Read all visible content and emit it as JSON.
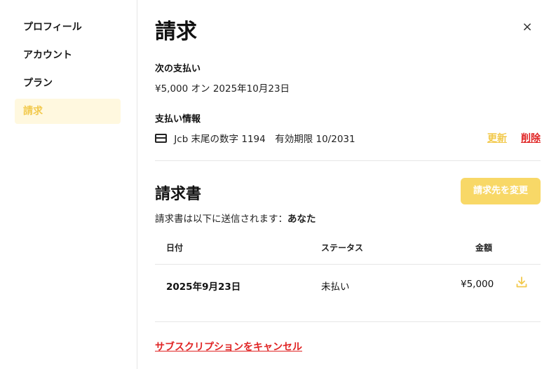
{
  "sidebar": {
    "items": [
      {
        "label": "プロフィール"
      },
      {
        "label": "アカウント"
      },
      {
        "label": "プラン"
      },
      {
        "label": "請求"
      }
    ]
  },
  "page": {
    "title": "請求",
    "close_icon": "×"
  },
  "next_payment": {
    "heading": "次の支払い",
    "text": "¥5,000 オン 2025年10月23日"
  },
  "payment_info": {
    "heading": "支払い情報",
    "card_text": "Jcb 末尾の数字 1194　有効期限 10/2031",
    "update_label": "更新",
    "delete_label": "削除"
  },
  "invoices": {
    "title": "請求書",
    "change_button": "請求先を変更",
    "sent_to_prefix": "請求書は以下に送信されます：",
    "sent_to_name": "あなた",
    "columns": [
      "日付",
      "ステータス",
      "金額"
    ],
    "rows": [
      {
        "date": "2025年9月23日",
        "status": "未払い",
        "amount": "¥5,000"
      }
    ]
  },
  "cancel_link": "サブスクリプションをキャンセル",
  "colors": {
    "accent": "#f2c94c",
    "danger": "#e02424",
    "button_bg": "#f8d867"
  }
}
